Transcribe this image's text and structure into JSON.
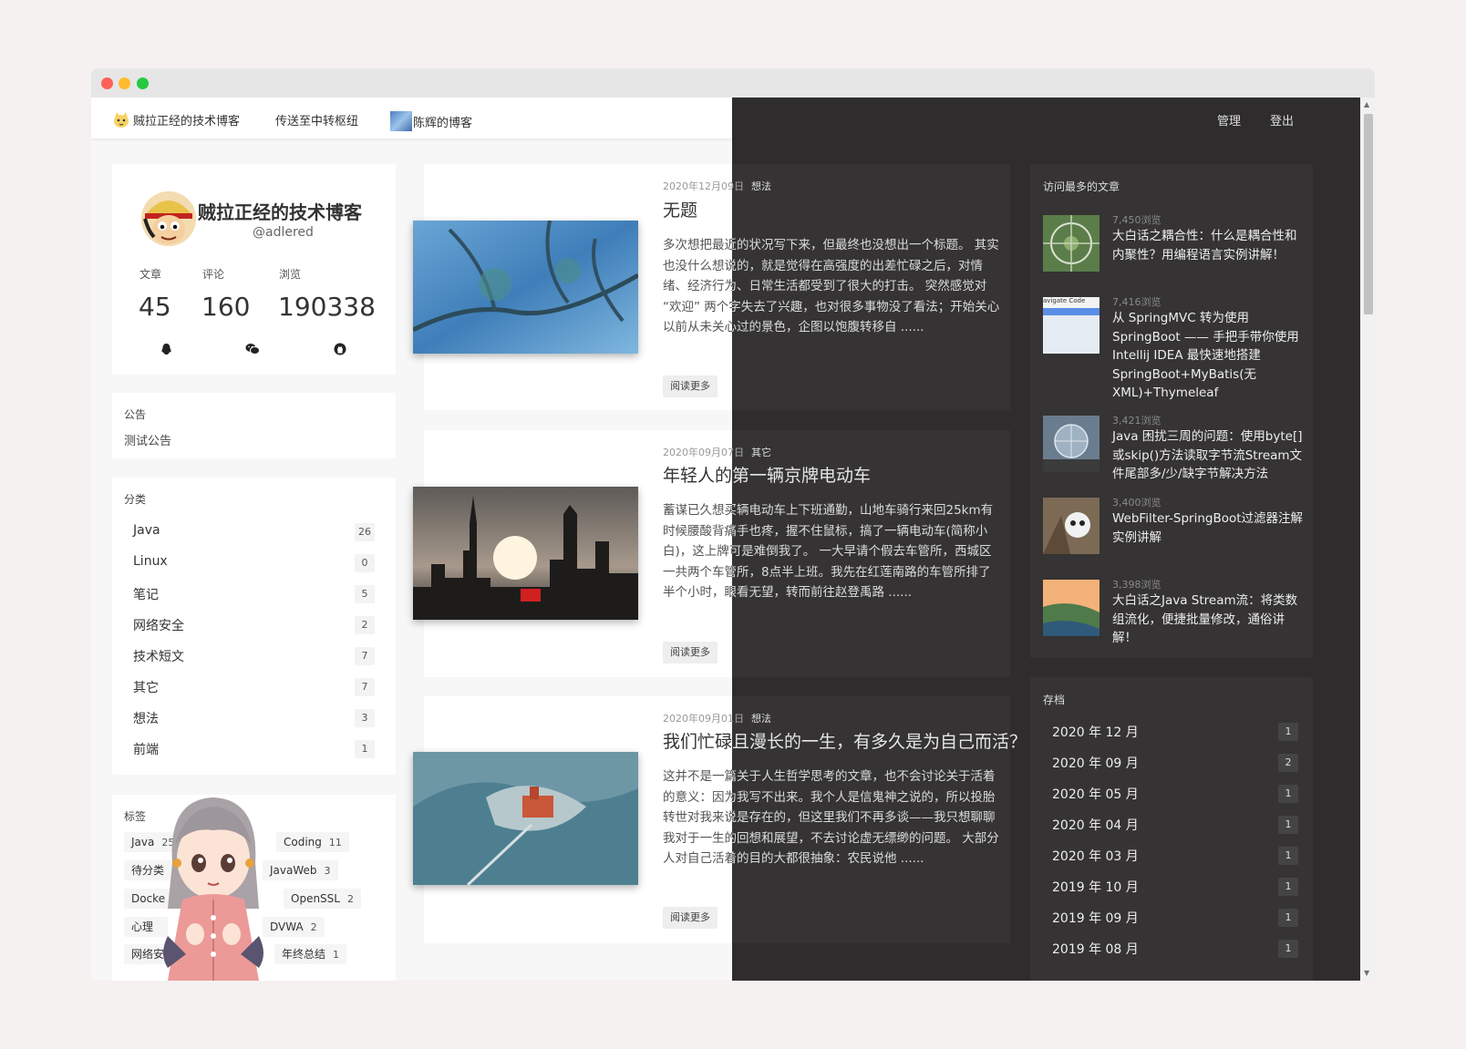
{
  "nav": {
    "links": [
      {
        "label": "贼拉正经的技术博客",
        "icon": "cat-emoji-icon"
      },
      {
        "label": "传送至中转枢纽",
        "icon": ""
      },
      {
        "label": "陈辉的博客",
        "icon": "blog-thumbnail-icon"
      }
    ],
    "manage": "管理",
    "logout": "登出"
  },
  "profile": {
    "name": "贼拉正经的技术博客",
    "handle": "@adlered",
    "stats": [
      {
        "label": "文章",
        "value": "45"
      },
      {
        "label": "评论",
        "value": "160"
      },
      {
        "label": "浏览",
        "value": "190338"
      }
    ],
    "social": [
      "qq-icon",
      "wechat-icon",
      "github-icon"
    ]
  },
  "notice": {
    "title": "公告",
    "text": "测试公告"
  },
  "categories": {
    "title": "分类",
    "items": [
      {
        "name": "Java",
        "count": "26"
      },
      {
        "name": "Linux",
        "count": "0"
      },
      {
        "name": "笔记",
        "count": "5"
      },
      {
        "name": "网络安全",
        "count": "2"
      },
      {
        "name": "技术短文",
        "count": "7"
      },
      {
        "name": "其它",
        "count": "7"
      },
      {
        "name": "想法",
        "count": "3"
      },
      {
        "name": "前端",
        "count": "1"
      }
    ]
  },
  "tags": {
    "title": "标签",
    "items": [
      {
        "name": "Java",
        "count": "25"
      },
      {
        "name": "Coding",
        "count": "11"
      },
      {
        "name": "待分类",
        "count": ""
      },
      {
        "name": "JavaWeb",
        "count": "3"
      },
      {
        "name": "Docke",
        "count": ""
      },
      {
        "name": "OpenSSL",
        "count": "2"
      },
      {
        "name": "心理",
        "count": ""
      },
      {
        "name": "DVWA",
        "count": "2"
      },
      {
        "name": "网络安",
        "count": ""
      },
      {
        "name": "年终总结",
        "count": "1"
      }
    ]
  },
  "posts": [
    {
      "date": "2020年12月09日",
      "category": "想法",
      "title": "无题",
      "excerpt": "多次想把最近的状况写下来，但最终也没想出一个标题。 其实也没什么想说的，就是觉得在高强度的出差忙碌之后，对情绪、经济行为、日常生活都受到了很大的打击。 突然感觉对 “欢迎” 两个字失去了兴趣，也对很多事物没了看法；开始关心以前从未关心过的景色，企图以饱腹转移自 ......",
      "read_more": "阅读更多"
    },
    {
      "date": "2020年09月07日",
      "category": "其它",
      "title": "年轻人的第一辆京牌电动车",
      "excerpt": "蓄谋已久想买辆电动车上下班通勤，山地车骑行来回25km有时候腰酸背痛手也疼，握不住鼠标，搞了一辆电动车(简称小白)，这上牌可是难倒我了。 一大早请个假去车管所，西城区一共两个车管所，8点半上班。我先在红莲南路的车管所排了半个小时，眼看无望，转而前往赵登禹路 ......",
      "read_more": "阅读更多"
    },
    {
      "date": "2020年09月01日",
      "category": "想法",
      "title": "我们忙碌且漫长的一生，有多久是为自己而活？",
      "excerpt": "这并不是一篇关于人生哲学思考的文章，也不会讨论关于活着的意义：因为我写不出来。我个人是信鬼神之说的，所以投胎转世对我来说是存在的，但这里我们不再多谈——我只想聊聊我对于一生的回想和展望，不去讨论虚无缥缈的问题。 大部分人对自己活着的目的大都很抽象：农民说他 ......",
      "read_more": "阅读更多"
    }
  ],
  "popular": {
    "title": "访问最多的文章",
    "items": [
      {
        "views": "7,450浏览",
        "title": "大白话之耦合性：什么是耦合性和内聚性？用编程语言实例讲解！"
      },
      {
        "views": "7,416浏览",
        "title": "从 SpringMVC 转为使用 SpringBoot —— 手把手带你使用 Intellij IDEA 最快速地搭建 SpringBoot+MyBatis(无XML)+Thymeleaf",
        "thumb_text": "avigate   Code"
      },
      {
        "views": "3,421浏览",
        "title": "Java 困扰三周的问题：使用byte[]或skip()方法读取字节流Stream文件尾部多/少/缺字节解决方法"
      },
      {
        "views": "3,400浏览",
        "title": "WebFilter-SpringBoot过滤器注解实例讲解"
      },
      {
        "views": "3,398浏览",
        "title": "大白话之Java Stream流：将类数组流化，便捷批量修改，通俗讲解！"
      }
    ]
  },
  "archive": {
    "title": "存档",
    "items": [
      {
        "month": "2020 年 12 月",
        "count": "1"
      },
      {
        "month": "2020 年 09 月",
        "count": "2"
      },
      {
        "month": "2020 年 05 月",
        "count": "1"
      },
      {
        "month": "2020 年 04 月",
        "count": "1"
      },
      {
        "month": "2020 年 03 月",
        "count": "1"
      },
      {
        "month": "2019 年 10 月",
        "count": "1"
      },
      {
        "month": "2019 年 09 月",
        "count": "1"
      },
      {
        "month": "2019 年 08 月",
        "count": "1"
      }
    ]
  },
  "colors": {
    "dark_bg": "#2e2c2c",
    "dark_card": "#353333",
    "light_bg": "#f7f7f7",
    "close": "#fe5f57",
    "minimize": "#febc2e",
    "zoom": "#28c840"
  }
}
